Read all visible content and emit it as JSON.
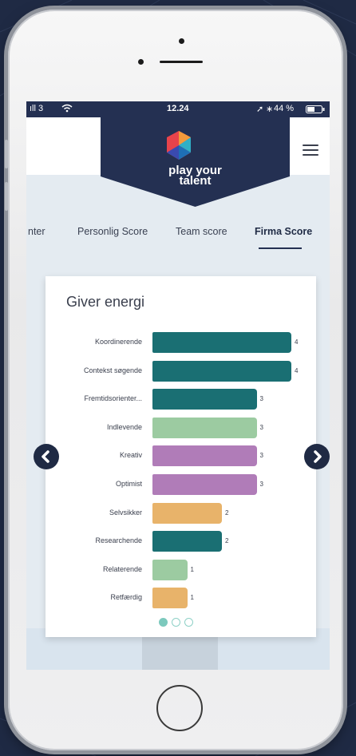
{
  "status_bar": {
    "signal": "ıll 3",
    "time": "12.24",
    "battery": "44 %"
  },
  "header": {
    "brand_line1": "play your",
    "brand_line2": "talent",
    "menu_icon": "hamburger-menu-icon"
  },
  "tabs": [
    {
      "label": "nter",
      "active": false
    },
    {
      "label": "Personlig Score",
      "active": false
    },
    {
      "label": "Team score",
      "active": false
    },
    {
      "label": "Firma Score",
      "active": true
    }
  ],
  "card": {
    "title": "Giver energi"
  },
  "colors": {
    "teal": "#1a6f73",
    "green": "#9ccba1",
    "purple": "#b07cb8",
    "orange": "#e8b36a",
    "navy": "#243052"
  },
  "chart_data": {
    "type": "bar",
    "orientation": "horizontal",
    "title": "Giver energi",
    "categories": [
      "Koordinerende",
      "Contekst søgende",
      "Fremtidsorienter...",
      "Indlevende",
      "Kreativ",
      "Optimist",
      "Selvsikker",
      "Researchende",
      "Relaterende",
      "Retfærdig"
    ],
    "values": [
      4,
      4,
      3,
      3,
      3,
      3,
      2,
      2,
      1,
      1
    ],
    "colors": [
      "#1a6f73",
      "#1a6f73",
      "#1a6f73",
      "#9ccba1",
      "#b07cb8",
      "#b07cb8",
      "#e8b36a",
      "#1a6f73",
      "#9ccba1",
      "#e8b36a"
    ],
    "xlim": [
      0,
      4
    ]
  },
  "pager": {
    "pages": 3,
    "current": 1
  },
  "nav_arrows": {
    "prev_icon": "chevron-left-icon",
    "next_icon": "chevron-right-icon"
  }
}
